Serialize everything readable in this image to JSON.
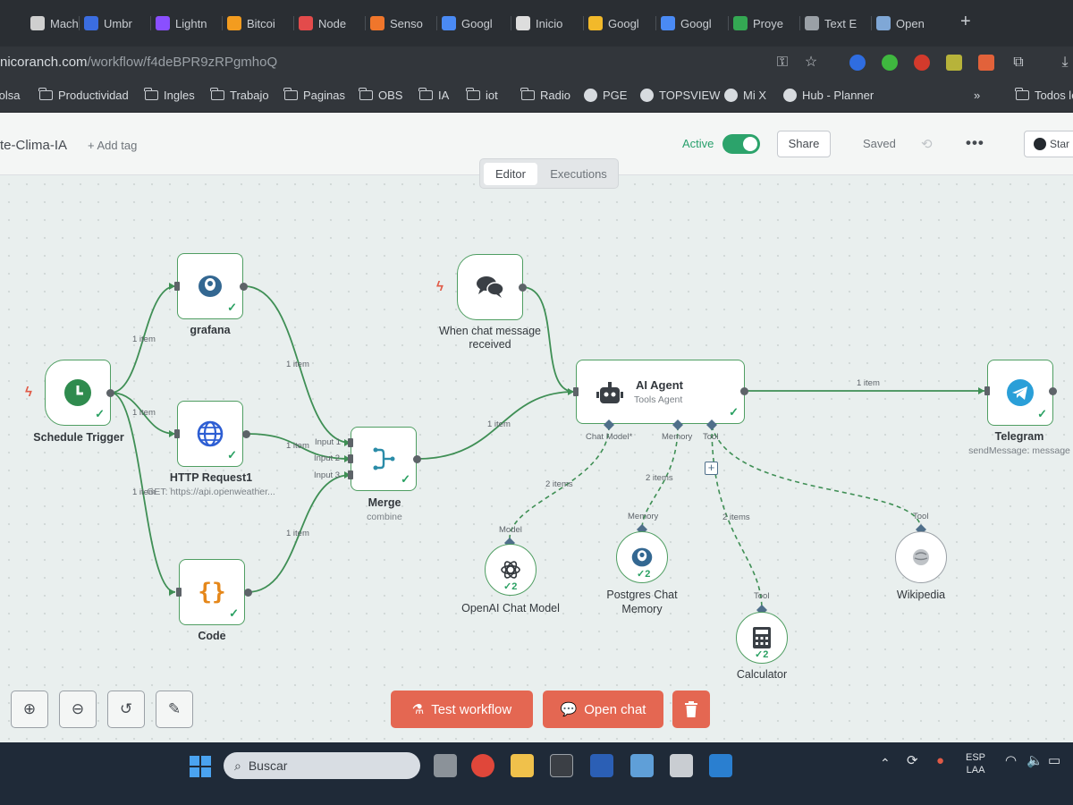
{
  "browser": {
    "tabs": [
      {
        "label": "Mach",
        "color": "#cfcfcf"
      },
      {
        "label": "Umbr",
        "color": "#3b6de0"
      },
      {
        "label": "Lightn",
        "color": "#8a4fff"
      },
      {
        "label": "Bitcoi",
        "color": "#f39c1f"
      },
      {
        "label": "Node",
        "color": "#e34b4b"
      },
      {
        "label": "Senso",
        "color": "#f0762b"
      },
      {
        "label": "Googl",
        "color": "#4a8af4"
      },
      {
        "label": "Inicio",
        "color": "#dddddd"
      },
      {
        "label": "Googl",
        "color": "#f2b92a"
      },
      {
        "label": "Googl",
        "color": "#4a8af4"
      },
      {
        "label": "Proye",
        "color": "#34a853"
      },
      {
        "label": "Text E",
        "color": "#9aa0a6"
      },
      {
        "label": "Open",
        "color": "#7fa7d6"
      }
    ],
    "new_tab": "+",
    "url_host": "nicoranch.com",
    "url_path": "/workflow/f4deBPR9zRPgmhoQ",
    "bookmarks": [
      "Bolsa",
      "Productividad",
      "Ingles",
      "Trabajo",
      "Paginas",
      "OBS",
      "IA",
      "iot",
      "Radio",
      "PGE",
      "TOPSVIEW",
      "Mi X",
      "Hub - Planner"
    ],
    "bookmarks_overflow": "»",
    "all_bookmarks": "Todos lo"
  },
  "header": {
    "workflow_name": "te-Clima-IA",
    "add_tag": "+ Add tag",
    "active_label": "Active",
    "active": true,
    "share": "Share",
    "saved": "Saved",
    "more": "•••",
    "star": "Star"
  },
  "view_tabs": {
    "editor": "Editor",
    "executions": "Executions"
  },
  "nodes": {
    "schedule": {
      "label": "Schedule Trigger"
    },
    "grafana": {
      "label": "grafana"
    },
    "http": {
      "label": "HTTP Request1",
      "sub": "GET: https://api.openweather..."
    },
    "code": {
      "label": "Code"
    },
    "merge": {
      "label": "Merge",
      "sub": "combine",
      "inputs": [
        "Input 1",
        "Input 2",
        "Input 3"
      ]
    },
    "chat": {
      "label1": "When chat message",
      "label2": "received"
    },
    "agent": {
      "label": "AI Agent",
      "sub": "Tools Agent",
      "ports": [
        "Chat Model*",
        "Memory",
        "Tool"
      ]
    },
    "telegram": {
      "label": "Telegram",
      "sub": "sendMessage: message"
    },
    "openai": {
      "label": "OpenAI Chat Model",
      "port": "Model",
      "count": "2"
    },
    "postgres": {
      "label1": "Postgres Chat",
      "label2": "Memory",
      "port": "Memory",
      "count": "2"
    },
    "calculator": {
      "label": "Calculator",
      "port": "Tool",
      "count": "2"
    },
    "wikipedia": {
      "label": "Wikipedia",
      "port": "Tool"
    }
  },
  "edges": {
    "one_item": "1 item",
    "two_items": "2 items"
  },
  "toolbar": {
    "test_workflow": "Test workflow",
    "open_chat": "Open chat"
  },
  "taskbar": {
    "search": "Buscar",
    "lang1": "ESP",
    "lang2": "LAA"
  }
}
